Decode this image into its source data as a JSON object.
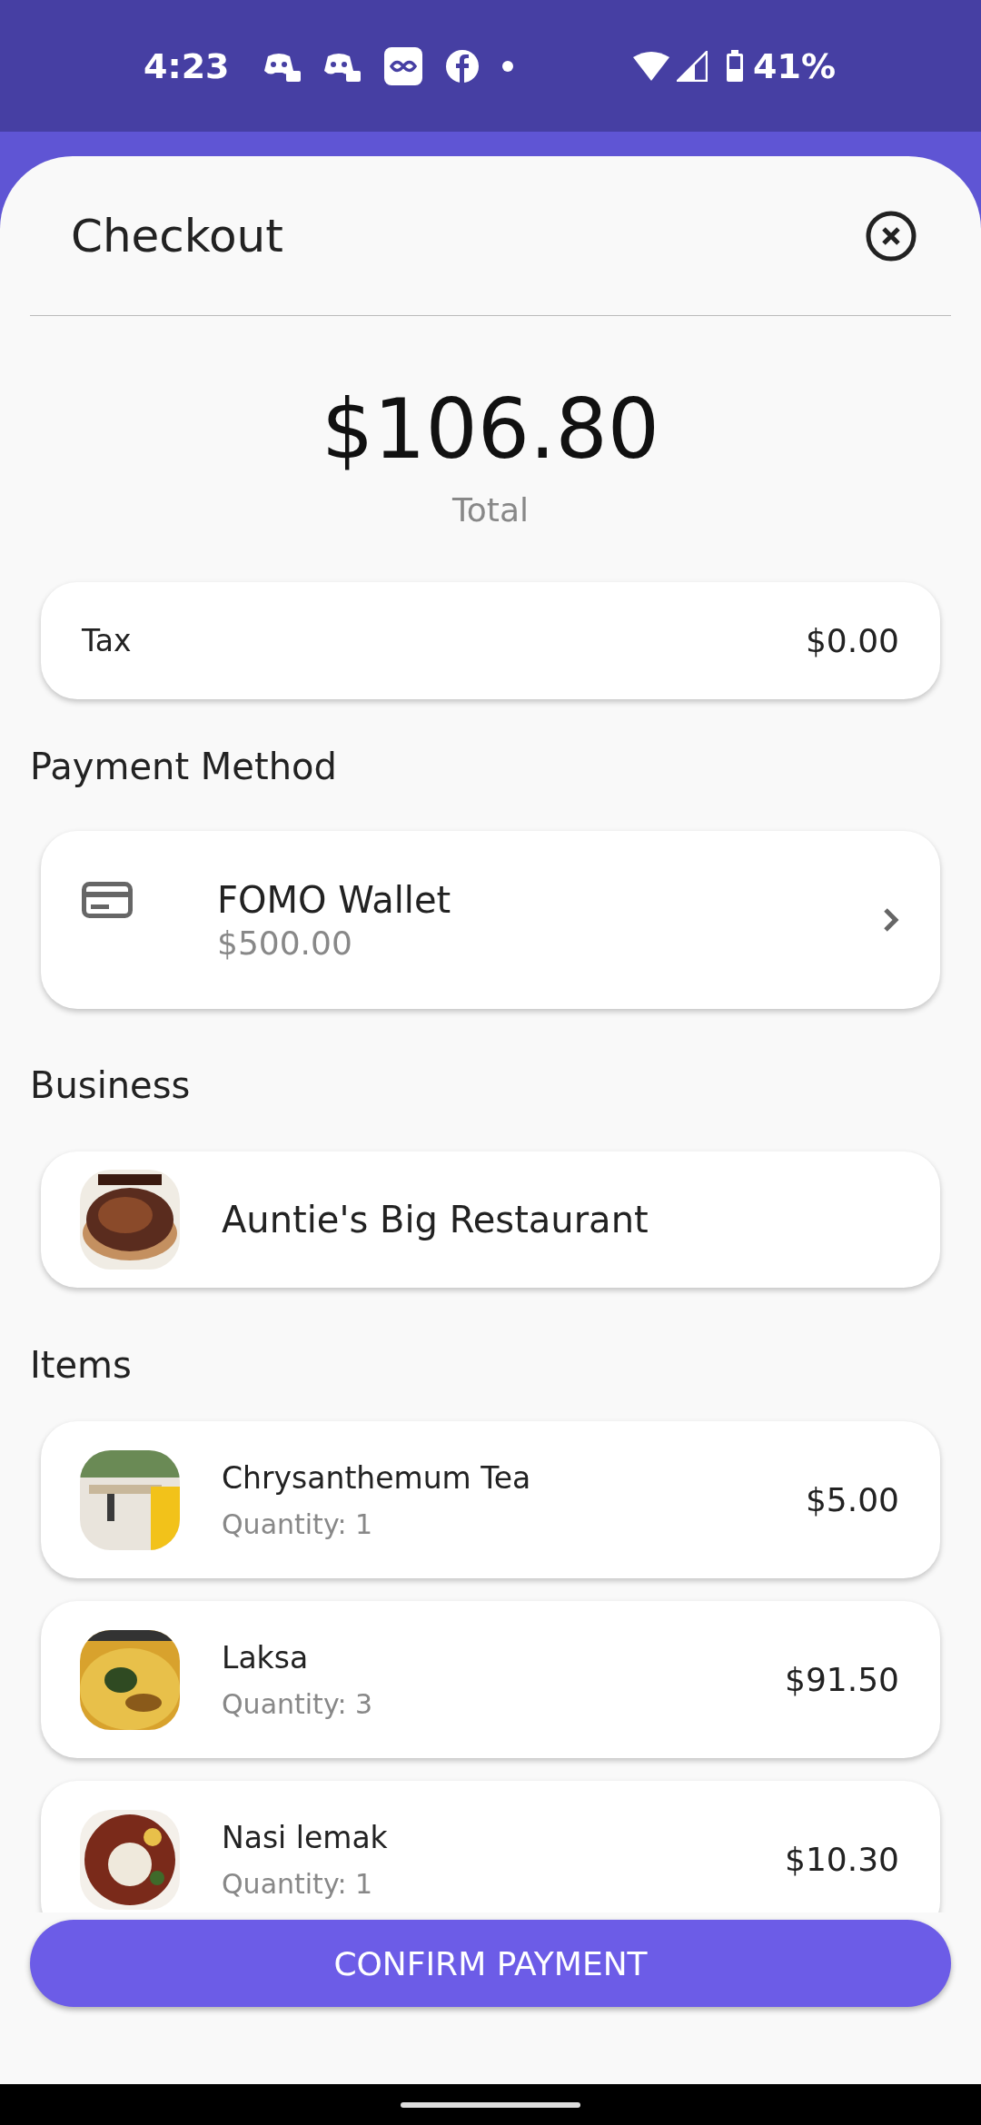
{
  "status_bar": {
    "time": "4:23",
    "battery": "41%"
  },
  "header": {
    "title": "Checkout"
  },
  "total": {
    "amount": "$106.80",
    "label": "Total"
  },
  "tax": {
    "label": "Tax",
    "amount": "$0.00"
  },
  "payment": {
    "heading": "Payment Method",
    "name": "FOMO Wallet",
    "balance": "$500.00"
  },
  "business": {
    "heading": "Business",
    "name": "Auntie's Big Restaurant"
  },
  "items": {
    "heading": "Items",
    "rows": [
      {
        "name": "Chrysanthemum Tea",
        "quantity": "Quantity: 1",
        "price": "$5.00"
      },
      {
        "name": "Laksa",
        "quantity": "Quantity: 3",
        "price": "$91.50"
      },
      {
        "name": "Nasi lemak",
        "quantity": "Quantity: 1",
        "price": "$10.30"
      }
    ]
  },
  "confirm_button": "CONFIRM PAYMENT"
}
